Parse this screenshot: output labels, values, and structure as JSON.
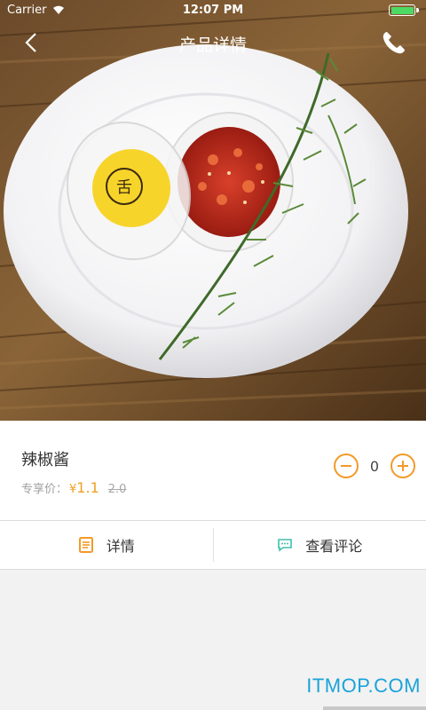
{
  "status_bar": {
    "carrier": "Carrier",
    "time": "12:07 PM",
    "wifi_icon": "wifi-icon",
    "battery_icon": "battery-icon",
    "battery_color": "#4cd964"
  },
  "nav": {
    "title": "产品详情",
    "back_icon": "chevron-left-icon",
    "call_icon": "phone-icon"
  },
  "hero": {
    "photo": "chili-sauce-on-plate-photo",
    "logo_text": "舌"
  },
  "product": {
    "name": "辣椒酱",
    "price_label": "专享价：",
    "currency": "¥",
    "price": "1.1",
    "original_price": "2.0",
    "quantity": "0",
    "accent_color": "#f39a28"
  },
  "tabs": [
    {
      "label": "详情",
      "icon": "document-icon",
      "icon_color": "#f39a28"
    },
    {
      "label": "查看评论",
      "icon": "chat-bubble-icon",
      "icon_color": "#3fbfae"
    }
  ],
  "watermark": "ITMOP.COM"
}
